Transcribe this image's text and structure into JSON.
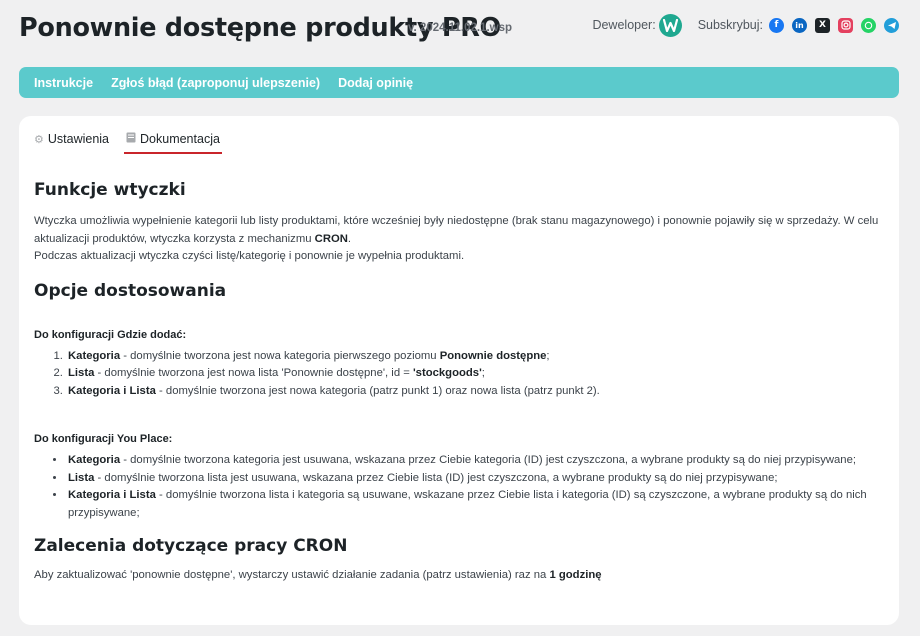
{
  "header": {
    "title": "Ponownie dostępne produkty PRO",
    "version": "v. 2024.11.02.1.wsp",
    "developer_label": "Deweloper:",
    "subscribe_label": "Subskrybuj:"
  },
  "menu": {
    "items": [
      {
        "label": "Instrukcje"
      },
      {
        "label": "Zgłoś błąd (zaproponuj ulepszenie)"
      },
      {
        "label": "Dodaj opinię"
      }
    ]
  },
  "tabs": [
    {
      "label": "Ustawienia",
      "icon": "gear-icon",
      "active": false
    },
    {
      "label": "Dokumentacja",
      "icon": "book-icon",
      "active": true
    }
  ],
  "doc": {
    "h_functions": "Funkcje wtyczki",
    "p1_a": "Wtyczka umożliwia wypełnienie kategorii lub listy produktami, które wcześniej były niedostępne (brak stanu magazynowego) i ponownie pojawiły się w sprzedaży. W celu aktualizacji produktów, wtyczka korzysta z mechanizmu ",
    "p1_b": "CRON",
    "p1_c": ".",
    "p2": "Podczas aktualizacji wtyczka czyści listę/kategorię i ponownie je wypełnia produktami.",
    "h_options": "Opcje dostosowania",
    "h_where": "Do konfiguracji Gdzie dodać:",
    "where_items": [
      {
        "b": "Kategoria",
        "t": " - domyślnie tworzona jest nowa kategoria pierwszego poziomu ",
        "b2": "Ponownie dostępne",
        "t2": ";"
      },
      {
        "b": "Lista",
        "t": " - domyślnie tworzona jest nowa lista 'Ponownie dostępne', id = ",
        "b2": "'stockgoods'",
        "t2": ";"
      },
      {
        "b": "Kategoria i Lista",
        "t": " - domyślnie tworzona jest nowa kategoria (patrz punkt 1) oraz nowa lista (patrz punkt 2).",
        "b2": "",
        "t2": ""
      }
    ],
    "h_place": "Do konfiguracji You Place:",
    "place_items": [
      {
        "b": "Kategoria",
        "t": " - domyślnie tworzona kategoria jest usuwana, wskazana przez Ciebie kategoria (ID) jest czyszczona, a wybrane produkty są do niej przypisywane;"
      },
      {
        "b": "Lista",
        "t": " - domyślnie tworzona lista jest usuwana, wskazana przez Ciebie lista (ID) jest czyszczona, a wybrane produkty są do niej przypisywane;"
      },
      {
        "b": "Kategoria i Lista",
        "t": " - domyślnie tworzona lista i kategoria są usuwane, wskazane przez Ciebie lista i kategoria (ID) są czyszczone, a wybrane produkty są do nich przypisywane;"
      }
    ],
    "h_cron": "Zalecenia dotyczące pracy CRON",
    "cron_a": "Aby zaktualizować 'ponownie dostępne', wystarczy ustawić działanie zadania (patrz ustawienia) raz na ",
    "cron_b": "1 godzinę"
  },
  "colors": {
    "menubar": "#5bcacc",
    "tab_underline": "#c9252b",
    "developer_logo": "#1fa890"
  },
  "social_icons": [
    "facebook-icon",
    "linkedin-icon",
    "x-icon",
    "instagram-icon",
    "whatsapp-icon",
    "telegram-icon"
  ]
}
